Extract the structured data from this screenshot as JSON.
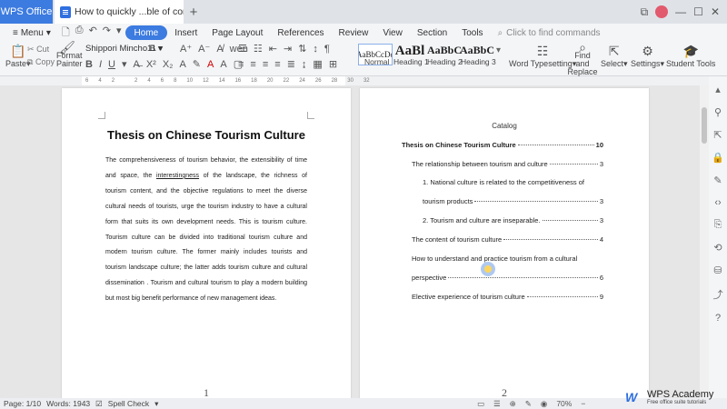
{
  "titlebar": {
    "app_tab": "WPS Office",
    "doc_tab": "How to quickly ...ble of contents",
    "add_tab": "+",
    "window_controls": [
      "⧉",
      "—",
      "☐",
      "✕"
    ]
  },
  "menubar": {
    "menu": "Menu",
    "items": [
      "Home",
      "Insert",
      "Page Layout",
      "References",
      "Review",
      "View",
      "Section",
      "Tools"
    ],
    "search": "Click to find commands",
    "quick_icons": [
      "🗋",
      "⎙",
      "↶",
      "↷",
      "▾"
    ]
  },
  "ribbon": {
    "paste": "Paste",
    "cut": "Cut",
    "copy": "Copy",
    "format_painter": "Format Painter",
    "font_name": "Shippori Mincho B",
    "font_size": "11",
    "styles": [
      {
        "preview": "AaBbCcDd",
        "label": "Normal"
      },
      {
        "preview": "AaBl",
        "label": "Heading 1"
      },
      {
        "preview": "AaBbC",
        "label": "Heading 2"
      },
      {
        "preview": "AaBbC",
        "label": "Heading 3"
      }
    ],
    "word_typesetting": "Word Typesetting",
    "find_replace": "Find and Replace",
    "select": "Select",
    "settings": "Settings",
    "student_tools": "Student Tools"
  },
  "ruler": {
    "ticks": [
      "6",
      "4",
      "2",
      "",
      "2",
      "4",
      "6",
      "8",
      "10",
      "12",
      "14",
      "16",
      "18",
      "20",
      "22",
      "24",
      "26",
      "28",
      "30",
      "32"
    ]
  },
  "page1": {
    "title": "Thesis on Chinese Tourism Culture",
    "body_pre": "The comprehensiveness of tourism behavior, the extensibility of time and space, the ",
    "body_ul": "interestingness",
    "body_post": " of the landscape, the richness of tourism content, and the objective regulations to meet the diverse cultural needs of tourists, urge the tourism industry to have a cultural form that suits its own development needs. This is tourism culture. Tourism culture can be divided into traditional tourism culture and modern tourism culture. The former mainly includes tourists and tourism landscape culture; the latter adds tourism culture and cultural dissemination . Tourism and cultural tourism to play a modern building but most big benefit performance of new management ideas.",
    "page_number": "1"
  },
  "page2": {
    "catalog": "Catalog",
    "toc": [
      {
        "text": "Thesis on Chinese Tourism Culture",
        "page": "10"
      },
      {
        "text": "The relationship between tourism and culture",
        "page": "3"
      },
      {
        "text": "1. National culture is related to the competitiveness of",
        "page": ""
      },
      {
        "text": "tourism products",
        "page": "3"
      },
      {
        "text": "2. Tourism and culture are inseparable.",
        "page": "3"
      },
      {
        "text": "The content of tourism culture",
        "page": "4"
      },
      {
        "text": "How to understand and practice tourism from a cultural",
        "page": ""
      },
      {
        "text": "perspective",
        "page": "6"
      },
      {
        "text": "Elective experience of tourism culture",
        "page": "9"
      }
    ],
    "page_number": "2"
  },
  "statusbar": {
    "page": "Page: 1/10",
    "words": "Words: 1943",
    "spell_check": "Spell Check",
    "zoom": "70%"
  },
  "watermark": {
    "logo": "W",
    "title": "WPS Academy",
    "subtitle": "Free office suite tutorials"
  }
}
